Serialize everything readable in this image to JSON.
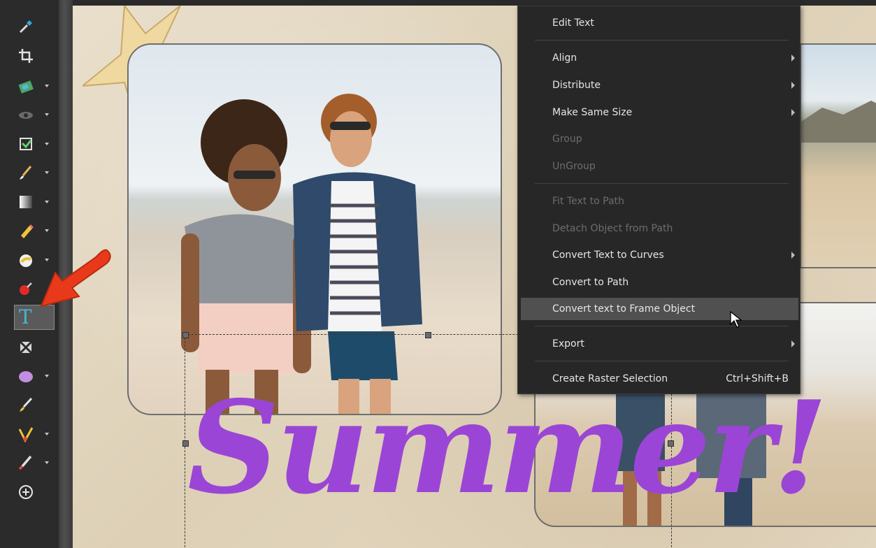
{
  "toolbar": {
    "tools": [
      {
        "name": "dropper-icon",
        "caret": false
      },
      {
        "name": "crop-icon",
        "caret": false
      },
      {
        "name": "straighten-icon",
        "caret": true
      },
      {
        "name": "eye-icon",
        "caret": true
      },
      {
        "name": "pick-tool-icon",
        "caret": true
      },
      {
        "name": "paint-brush-icon",
        "caret": true
      },
      {
        "name": "gradient-icon",
        "caret": true
      },
      {
        "name": "pencil-eraser-icon",
        "caret": true
      },
      {
        "name": "fill-bucket-icon",
        "caret": true
      },
      {
        "name": "pin-icon",
        "caret": false
      },
      {
        "name": "text-tool-icon",
        "caret": false,
        "active": true,
        "glyph": "T"
      },
      {
        "name": "transparency-icon",
        "caret": false
      },
      {
        "name": "ellipse-icon",
        "caret": true
      },
      {
        "name": "brush-icon",
        "caret": false
      },
      {
        "name": "pen-icon",
        "caret": true
      },
      {
        "name": "smudge-icon",
        "caret": true
      },
      {
        "name": "add-icon",
        "caret": false
      }
    ]
  },
  "canvas": {
    "overlay_text": "Summer!",
    "overlay_color": "#9b45d6"
  },
  "context_menu": {
    "items": [
      {
        "label": "Edit Text",
        "enabled": true,
        "submenu": false
      },
      {
        "label": "Align",
        "enabled": true,
        "submenu": true
      },
      {
        "label": "Distribute",
        "enabled": true,
        "submenu": true
      },
      {
        "label": "Make Same Size",
        "enabled": true,
        "submenu": true
      },
      {
        "label": "Group",
        "enabled": false,
        "submenu": false
      },
      {
        "label": "UnGroup",
        "enabled": false,
        "submenu": false
      },
      {
        "label": "Fit Text to Path",
        "enabled": false,
        "submenu": false
      },
      {
        "label": "Detach Object from Path",
        "enabled": false,
        "submenu": false
      },
      {
        "label": "Convert Text to Curves",
        "enabled": true,
        "submenu": true
      },
      {
        "label": "Convert to Path",
        "enabled": true,
        "submenu": false
      },
      {
        "label": "Convert text to Frame Object",
        "enabled": true,
        "submenu": false,
        "highlighted": true
      },
      {
        "label": "Export",
        "enabled": true,
        "submenu": true
      },
      {
        "label": "Create Raster Selection",
        "enabled": true,
        "submenu": false,
        "shortcut": "Ctrl+Shift+B"
      }
    ]
  }
}
